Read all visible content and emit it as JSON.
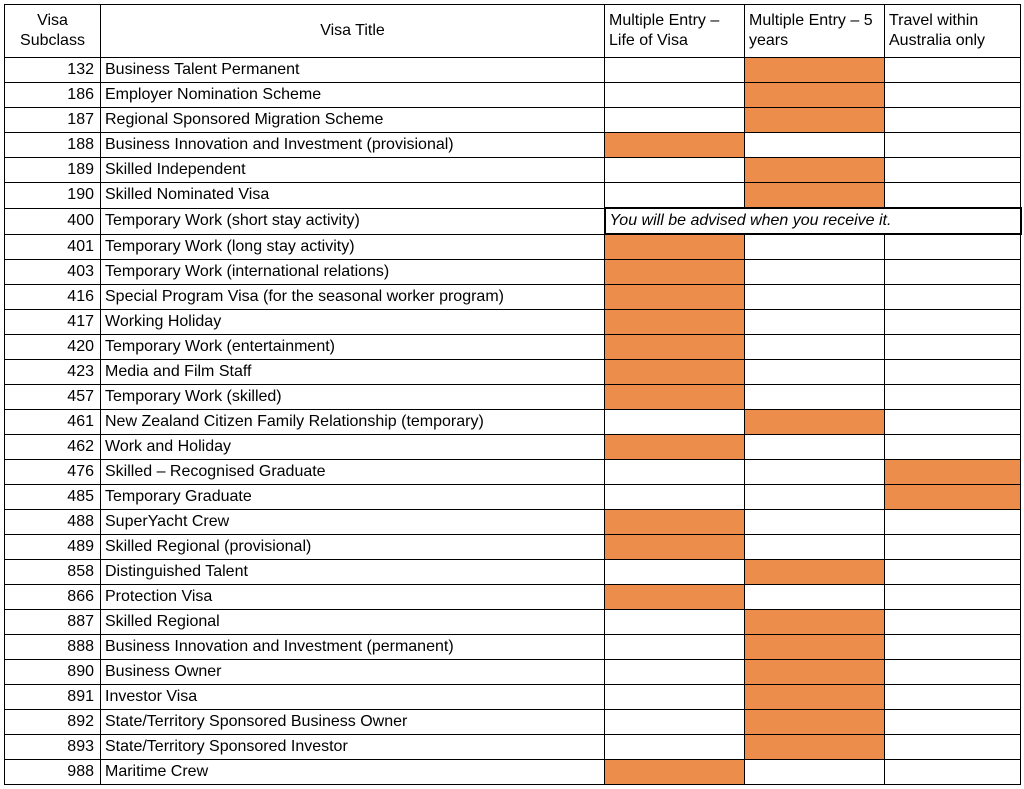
{
  "headers": {
    "subclass": "Visa Subclass",
    "title": "Visa Title",
    "life": "Multiple Entry – Life of Visa",
    "five": "Multiple Entry – 5 years",
    "aus": "Travel within Australia only"
  },
  "advise_text": "You will be advised when you receive it.",
  "rows": [
    {
      "sub": "132",
      "title": "Business Talent Permanent",
      "life": false,
      "five": true,
      "aus": false
    },
    {
      "sub": "186",
      "title": "Employer Nomination Scheme",
      "life": false,
      "five": true,
      "aus": false
    },
    {
      "sub": "187",
      "title": "Regional Sponsored Migration Scheme",
      "life": false,
      "five": true,
      "aus": false
    },
    {
      "sub": "188",
      "title": "Business Innovation and Investment (provisional)",
      "life": true,
      "five": false,
      "aus": false
    },
    {
      "sub": "189",
      "title": "Skilled Independent",
      "life": false,
      "five": true,
      "aus": false
    },
    {
      "sub": "190",
      "title": "Skilled Nominated Visa",
      "life": false,
      "five": true,
      "aus": false
    },
    {
      "sub": "400",
      "title": "Temporary Work (short stay activity)",
      "advise": true
    },
    {
      "sub": "401",
      "title": "Temporary Work (long stay activity)",
      "life": true,
      "five": false,
      "aus": false
    },
    {
      "sub": "403",
      "title": "Temporary Work (international relations)",
      "life": true,
      "five": false,
      "aus": false
    },
    {
      "sub": "416",
      "title": "Special Program Visa (for the seasonal worker program)",
      "life": true,
      "five": false,
      "aus": false
    },
    {
      "sub": "417",
      "title": "Working Holiday",
      "life": true,
      "five": false,
      "aus": false
    },
    {
      "sub": "420",
      "title": "Temporary Work (entertainment)",
      "life": true,
      "five": false,
      "aus": false
    },
    {
      "sub": "423",
      "title": "Media and Film Staff",
      "life": true,
      "five": false,
      "aus": false
    },
    {
      "sub": "457",
      "title": "Temporary Work (skilled)",
      "life": true,
      "five": false,
      "aus": false
    },
    {
      "sub": "461",
      "title": "New Zealand Citizen Family Relationship (temporary)",
      "life": false,
      "five": true,
      "aus": false
    },
    {
      "sub": "462",
      "title": "Work and Holiday",
      "life": true,
      "five": false,
      "aus": false
    },
    {
      "sub": "476",
      "title": "Skilled – Recognised Graduate",
      "life": false,
      "five": false,
      "aus": true
    },
    {
      "sub": "485",
      "title": "Temporary Graduate",
      "life": false,
      "five": false,
      "aus": true
    },
    {
      "sub": "488",
      "title": "SuperYacht Crew",
      "life": true,
      "five": false,
      "aus": false
    },
    {
      "sub": "489",
      "title": "Skilled Regional (provisional)",
      "life": true,
      "five": false,
      "aus": false
    },
    {
      "sub": "858",
      "title": "Distinguished Talent",
      "life": false,
      "five": true,
      "aus": false
    },
    {
      "sub": "866",
      "title": "Protection Visa",
      "life": true,
      "five": false,
      "aus": false
    },
    {
      "sub": "887",
      "title": "Skilled Regional",
      "life": false,
      "five": true,
      "aus": false
    },
    {
      "sub": "888",
      "title": "Business Innovation and Investment (permanent)",
      "life": false,
      "five": true,
      "aus": false
    },
    {
      "sub": "890",
      "title": "Business Owner",
      "life": false,
      "five": true,
      "aus": false
    },
    {
      "sub": "891",
      "title": "Investor Visa",
      "life": false,
      "five": true,
      "aus": false
    },
    {
      "sub": "892",
      "title": "State/Territory Sponsored Business Owner",
      "life": false,
      "five": true,
      "aus": false
    },
    {
      "sub": "893",
      "title": "State/Territory Sponsored Investor",
      "life": false,
      "five": true,
      "aus": false
    },
    {
      "sub": "988",
      "title": "Maritime Crew",
      "life": true,
      "five": false,
      "aus": false
    }
  ]
}
